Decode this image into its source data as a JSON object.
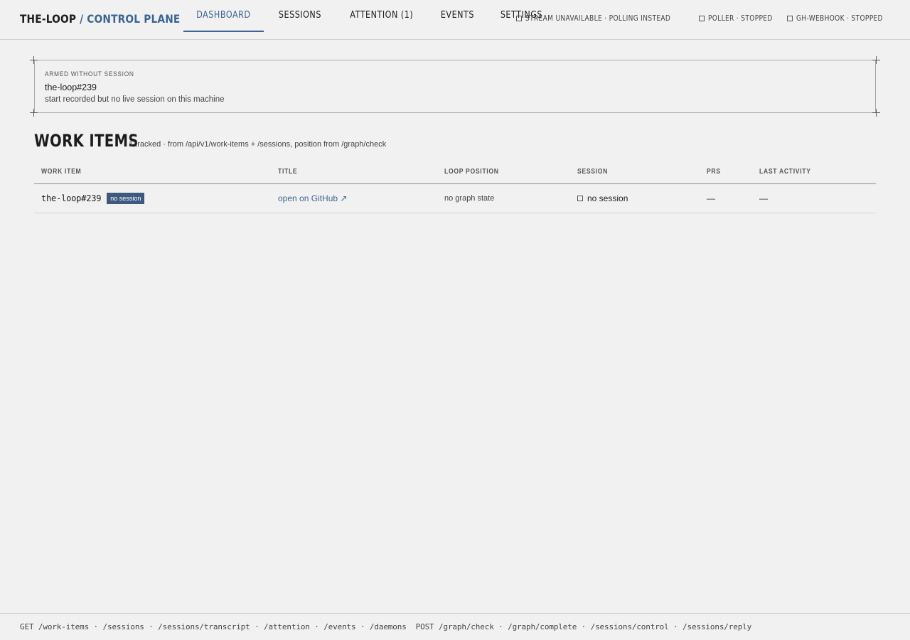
{
  "app": {
    "brand": "THE-LOOP",
    "brand_suffix": " / CONTROL PLANE"
  },
  "nav": {
    "tabs": [
      {
        "label": "DASHBOARD",
        "active": true
      },
      {
        "label": "SESSIONS",
        "active": false
      },
      {
        "label": "ATTENTION (1)",
        "active": false
      },
      {
        "label": "EVENTS",
        "active": false
      },
      {
        "label": "SETTINGS",
        "active": false
      }
    ]
  },
  "status": {
    "items": [
      {
        "label": "STREAM UNAVAILABLE · POLLING INSTEAD",
        "icon": "square-icon"
      },
      {
        "label": "POLLER · STOPPED",
        "icon": "square-icon"
      },
      {
        "label": "GH-WEBHOOK · STOPPED",
        "icon": "square-icon"
      }
    ]
  },
  "armed": {
    "kicker": "ARMED WITHOUT SESSION",
    "id": "the-loop#239",
    "description": "start recorded but no live session on this machine"
  },
  "work_items": {
    "title": "WORK ITEMS",
    "subtitle": "1 tracked · from /api/v1/work-items + /sessions, position from /graph/check",
    "columns": [
      "WORK ITEM",
      "TITLE",
      "LOOP POSITION",
      "SESSION",
      "PRS",
      "LAST ACTIVITY"
    ],
    "rows": [
      {
        "id": "the-loop#239",
        "badge": "no session",
        "title": "open on GitHub ↗",
        "position": "no graph state",
        "session": "no session",
        "prs": "—",
        "last_activity": "—"
      }
    ]
  },
  "footer": {
    "endpoints": "GET /work-items · /sessions · /sessions/transcript · /attention · /events · /daemons  POST /graph/check · /graph/complete · /sessions/control · /sessions/reply"
  },
  "colors": {
    "accent": "#3d6491",
    "badge": "#3d5a7e",
    "background": "#f1f1f1"
  }
}
